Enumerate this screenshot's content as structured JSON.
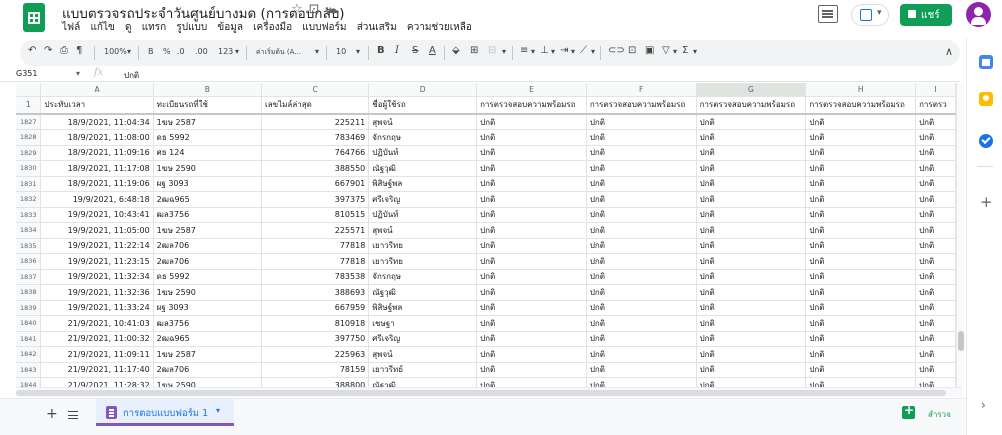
{
  "header": {
    "title": "แบบตรวจรถประจำวันศูนย์บางมด (การตอบกลับ)",
    "title_icons": [
      "star-icon",
      "move-icon",
      "cloud-status-icon"
    ],
    "menu": [
      "ไฟล์",
      "แก้ไข",
      "ดู",
      "แทรก",
      "รูปแบบ",
      "ข้อมูล",
      "เครื่องมือ",
      "แบบฟอร์ม",
      "ส่วนเสริม",
      "ความช่วยเหลือ"
    ],
    "share_label": "แชร์"
  },
  "toolbar": {
    "zoom": "100%",
    "currency": "B",
    "percent": "%",
    "dec_less": ".0",
    "dec_more": ".00",
    "format_more": "123",
    "font": "ค่าเริ่มต้น (A...",
    "font_size": "10",
    "bold": "B",
    "italic": "I",
    "strike": "S",
    "text_color": "A"
  },
  "formula_bar": {
    "cell_ref": "G351",
    "fx": "fx",
    "value": "ปกติ"
  },
  "columns": [
    "A",
    "B",
    "C",
    "D",
    "E",
    "F",
    "G",
    "H",
    "I"
  ],
  "selected_column": "G",
  "header_row": {
    "num": "1",
    "cells": [
      "ประทับเวลา",
      "ทะเบียนรถที่ใช้",
      "เลขไมล์ล่าสุด",
      "ชื่อผู้ใช้รถ",
      "การตรวจสอบความพร้อมรถ",
      "การตรวจสอบความพร้อมรถ",
      "การตรวจสอบความพร้อมรถ",
      "การตรวจสอบความพร้อมรถ",
      "การตรว"
    ]
  },
  "rows": [
    {
      "num": "1827",
      "a": "18/9/2021, 11:04:34",
      "b": "1ฆษ 2587",
      "c": "225211",
      "d": "สุพจน์",
      "e": "ปกติ",
      "f": "ปกติ",
      "g": "ปกติ",
      "h": "ปกติ",
      "i": "ปกติ"
    },
    {
      "num": "1828",
      "a": "18/9/2021, 11:08:00",
      "b": "ดธ 5992",
      "c": "783469",
      "d": "จักรกฤษ",
      "e": "ปกติ",
      "f": "ปกติ",
      "g": "ปกติ",
      "h": "ปกติ",
      "i": "ปกติ"
    },
    {
      "num": "1829",
      "a": "18/9/2021, 11:09:16",
      "b": "ศธ 124",
      "c": "764766",
      "d": "ปฏิบันท์",
      "e": "ปกติ",
      "f": "ปกติ",
      "g": "ปกติ",
      "h": "ปกติ",
      "i": "ปกติ"
    },
    {
      "num": "1830",
      "a": "18/9/2021, 11:17:08",
      "b": "1ฆษ 2590",
      "c": "388550",
      "d": "ณัฐวุฒิ",
      "e": "ปกติ",
      "f": "ปกติ",
      "g": "ปกติ",
      "h": "ปกติ",
      "i": "ปกติ"
    },
    {
      "num": "1831",
      "a": "18/9/2021, 11:19:06",
      "b": "ผฐ 3093",
      "c": "667901",
      "d": "พิสิษฐ์พล",
      "e": "ปกติ",
      "f": "ปกติ",
      "g": "ปกติ",
      "h": "ปกติ",
      "i": "ปกติ"
    },
    {
      "num": "1832",
      "a": "19/9/2021, 6:48:18",
      "b": "2ฒฉ965",
      "c": "397375",
      "d": "ศรีเจริญ",
      "e": "ปกติ",
      "f": "ปกติ",
      "g": "ปกติ",
      "h": "ปกติ",
      "i": "ปกติ"
    },
    {
      "num": "1833",
      "a": "19/9/2021, 10:43:41",
      "b": "ฒล3756",
      "c": "810515",
      "d": "ปฏิบันท์",
      "e": "ปกติ",
      "f": "ปกติ",
      "g": "ปกติ",
      "h": "ปกติ",
      "i": "ปกติ"
    },
    {
      "num": "1834",
      "a": "19/9/2021, 11:05:00",
      "b": "1ฆษ 2587",
      "c": "225571",
      "d": "สุพจน์",
      "e": "ปกติ",
      "f": "ปกติ",
      "g": "ปกติ",
      "h": "ปกติ",
      "i": "ปกติ"
    },
    {
      "num": "1835",
      "a": "19/9/2021, 11:22:14",
      "b": "2ฒล706",
      "c": "77818",
      "d": "เยาวรีทย",
      "e": "ปกติ",
      "f": "ปกติ",
      "g": "ปกติ",
      "h": "ปกติ",
      "i": "ปกติ"
    },
    {
      "num": "1836",
      "a": "19/9/2021, 11:23:15",
      "b": "2ฒล706",
      "c": "77818",
      "d": "เยาวรีทย",
      "e": "ปกติ",
      "f": "ปกติ",
      "g": "ปกติ",
      "h": "ปกติ",
      "i": "ปกติ"
    },
    {
      "num": "1837",
      "a": "19/9/2021, 11:32:34",
      "b": "ดธ 5992",
      "c": "783538",
      "d": "จักรกฤษ",
      "e": "ปกติ",
      "f": "ปกติ",
      "g": "ปกติ",
      "h": "ปกติ",
      "i": "ปกติ"
    },
    {
      "num": "1838",
      "a": "19/9/2021, 11:32:36",
      "b": "1ฆษ 2590",
      "c": "388693",
      "d": "ณัฐวุฒิ",
      "e": "ปกติ",
      "f": "ปกติ",
      "g": "ปกติ",
      "h": "ปกติ",
      "i": "ปกติ"
    },
    {
      "num": "1839",
      "a": "19/9/2021, 11:33:24",
      "b": "ผฐ 3093",
      "c": "667959",
      "d": "พิสิษฐ์พล",
      "e": "ปกติ",
      "f": "ปกติ",
      "g": "ปกติ",
      "h": "ปกติ",
      "i": "ปกติ"
    },
    {
      "num": "1840",
      "a": "21/9/2021, 10:41:03",
      "b": "ฒล3756",
      "c": "810918",
      "d": "เชษฐา",
      "e": "ปกติ",
      "f": "ปกติ",
      "g": "ปกติ",
      "h": "ปกติ",
      "i": "ปกติ"
    },
    {
      "num": "1841",
      "a": "21/9/2021, 11:00:32",
      "b": "2ฒฉ965",
      "c": "397750",
      "d": "ศรีเจริญ",
      "e": "ปกติ",
      "f": "ปกติ",
      "g": "ปกติ",
      "h": "ปกติ",
      "i": "ปกติ"
    },
    {
      "num": "1842",
      "a": "21/9/2021, 11:09:11",
      "b": "1ฆษ 2587",
      "c": "225963",
      "d": "สุพจน์",
      "e": "ปกติ",
      "f": "ปกติ",
      "g": "ปกติ",
      "h": "ปกติ",
      "i": "ปกติ"
    },
    {
      "num": "1843",
      "a": "21/9/2021, 11:17:40",
      "b": "2ฒล706",
      "c": "78159",
      "d": "เยาวรีทย์",
      "e": "ปกติ",
      "f": "ปกติ",
      "g": "ปกติ",
      "h": "ปกติ",
      "i": "ปกติ"
    },
    {
      "num": "1844",
      "a": "21/9/2021, 11:28:32",
      "b": "1ฆษ 2590",
      "c": "388800",
      "d": "ณัฐวุฒิ",
      "e": "ปกติ",
      "f": "ปกติ",
      "g": "ปกติ",
      "h": "ปกติ",
      "i": "ปกติ"
    }
  ],
  "bottom_bar": {
    "sheet_tab": "การตอบแบบฟอร์ม 1",
    "explore": "สำรวจ"
  },
  "colors": {
    "brand_green": "#0f9d58",
    "form_purple": "#7e57c2",
    "link_blue": "#1a73e8"
  }
}
